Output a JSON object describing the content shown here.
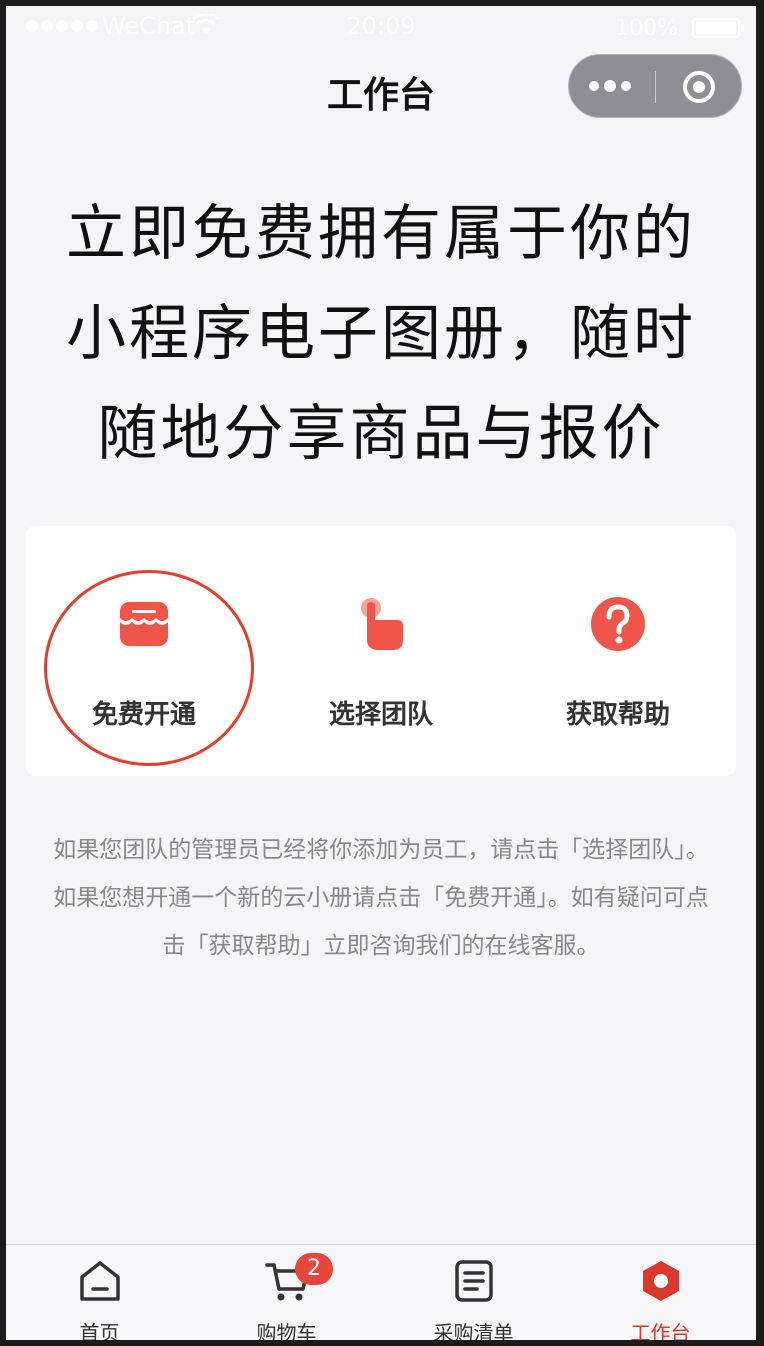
{
  "status_bar": {
    "carrier": "WeChat",
    "time": "20:09",
    "battery": "100%"
  },
  "nav": {
    "title": "工作台"
  },
  "hero": {
    "lines": [
      "立即免费拥有属于你的",
      "小程序电子图册，随时",
      "随地分享商品与报价"
    ]
  },
  "actions": [
    {
      "label": "免费开通",
      "icon": "store-icon"
    },
    {
      "label": "选择团队",
      "icon": "hand-tap-icon"
    },
    {
      "label": "获取帮助",
      "icon": "question-icon"
    }
  ],
  "description": "如果您团队的管理员已经将你添加为员工，请点击「选择团队」。如果您想开通一个新的云小册请点击「免费开通」。如有疑问可点击「获取帮助」立即咨询我们的在线客服。",
  "tabbar": {
    "items": [
      {
        "label": "首页",
        "icon": "home-icon"
      },
      {
        "label": "购物车",
        "icon": "cart-icon",
        "badge": "2"
      },
      {
        "label": "采购清单",
        "icon": "list-icon"
      },
      {
        "label": "工作台",
        "icon": "hexagon-icon",
        "active": true
      }
    ]
  },
  "colors": {
    "accent": "#e8463a",
    "active_tab": "#d9382a",
    "highlight_ring": "#e43f2b"
  }
}
